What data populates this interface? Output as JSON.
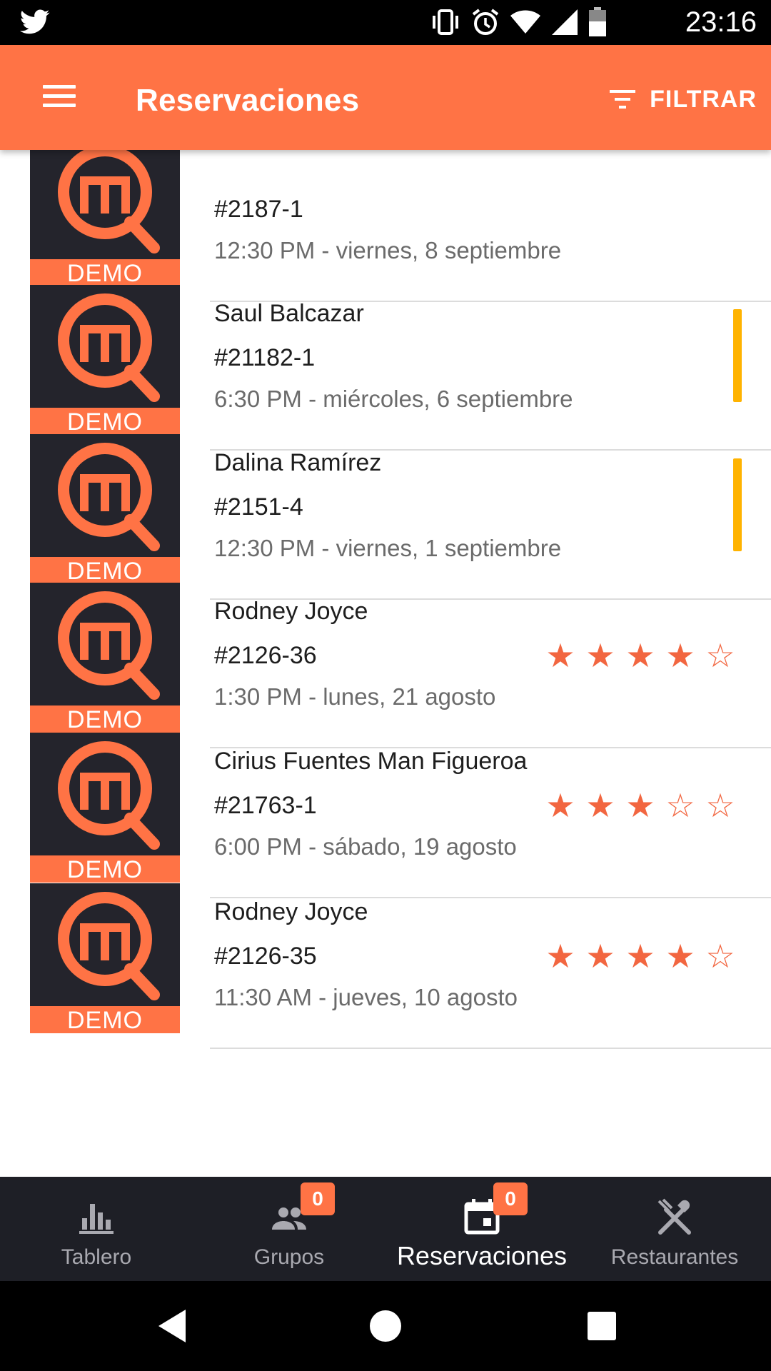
{
  "status_bar": {
    "time": "23:16",
    "icons": [
      "twitter-icon",
      "vibrate-icon",
      "alarm-icon",
      "wifi-icon",
      "signal-icon",
      "battery-icon"
    ]
  },
  "app_bar": {
    "title": "Reservaciones",
    "filter_label": "FILTRAR",
    "accent_color": "#ff7345"
  },
  "reservations": [
    {
      "name": "",
      "code": "#2187-1",
      "when": "12:30 PM - viernes, 8 septiembre",
      "status": "none",
      "rating": null,
      "thumb_label": "DEMO"
    },
    {
      "name": "Saul Balcazar",
      "code": "#21182-1",
      "when": "6:30 PM - miércoles, 6 septiembre",
      "status": "pending",
      "rating": null,
      "thumb_label": "DEMO"
    },
    {
      "name": "Dalina Ramírez",
      "code": "#2151-4",
      "when": "12:30 PM - viernes, 1 septiembre",
      "status": "pending",
      "rating": null,
      "thumb_label": "DEMO"
    },
    {
      "name": "Rodney Joyce",
      "code": "#2126-36",
      "when": "1:30 PM - lunes, 21 agosto",
      "status": "rated",
      "rating": 4,
      "thumb_label": "DEMO"
    },
    {
      "name": "Cirius Fuentes Man Figueroa",
      "code": "#21763-1",
      "when": "6:00 PM - sábado, 19 agosto",
      "status": "rated",
      "rating": 3,
      "thumb_label": "DEMO"
    },
    {
      "name": "Rodney Joyce",
      "code": "#2126-35",
      "when": "11:30 AM - jueves, 10 agosto",
      "status": "rated",
      "rating": 4,
      "thumb_label": "DEMO"
    }
  ],
  "bottom_nav": {
    "tabs": [
      {
        "label": "Tablero",
        "icon": "bar-chart-icon",
        "badge": null,
        "active": false
      },
      {
        "label": "Grupos",
        "icon": "group-icon",
        "badge": "0",
        "active": false
      },
      {
        "label": "Reservaciones",
        "icon": "calendar-icon",
        "badge": "0",
        "active": true
      },
      {
        "label": "Restaurantes",
        "icon": "fork-knife-icon",
        "badge": null,
        "active": false
      }
    ]
  },
  "system_nav": [
    "back-icon",
    "home-icon",
    "recents-icon"
  ],
  "colors": {
    "pending_flag": "#ffb300",
    "star": "#f26640",
    "nav_bg": "#1e1f26"
  }
}
